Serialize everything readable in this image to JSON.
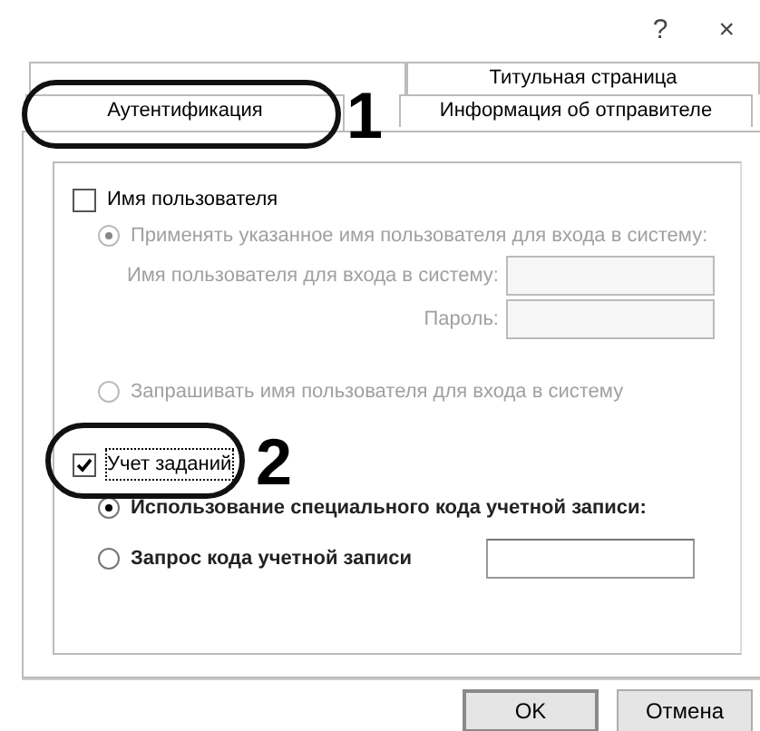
{
  "window": {
    "controls": [
      "?",
      "×"
    ]
  },
  "tabs": {
    "back_row": [
      {
        "selected": false
      },
      {
        "label": "Титульная страница",
        "selected": false
      }
    ],
    "front_row": [
      {
        "label": "Аутентификация",
        "selected": true
      },
      {
        "label": "Информация об отправителе",
        "selected": false
      }
    ]
  },
  "group": {
    "items": [
      {
        "kind": "checkbox",
        "label": "Имя пользователя",
        "checked": false,
        "disabled": false
      },
      {
        "kind": "radio",
        "label": "Применять указанное имя пользователя для входа в систему:",
        "selected": true,
        "disabled": true
      },
      {
        "kind": "field",
        "label": "Имя пользователя для входа в систему:",
        "disabled": true
      },
      {
        "kind": "field",
        "label": "Пароль:",
        "disabled": true
      },
      {
        "kind": "radio",
        "label": "Запрашивать имя пользователя для входа в систему",
        "selected": false,
        "disabled": true
      },
      {
        "kind": "checkbox",
        "label": "Учет заданий",
        "checked": true,
        "disabled": false
      },
      {
        "kind": "radio",
        "label": "Использование специального кода учетной записи:",
        "selected": true,
        "disabled": false
      },
      {
        "kind": "radio_field",
        "label": "Запрос кода учетной записи",
        "selected": false,
        "disabled": false
      }
    ]
  },
  "annotations": [
    {
      "label": "1"
    },
    {
      "label": "2"
    }
  ],
  "buttons": [
    {
      "label": "OK"
    },
    {
      "label": "Отмена"
    }
  ]
}
